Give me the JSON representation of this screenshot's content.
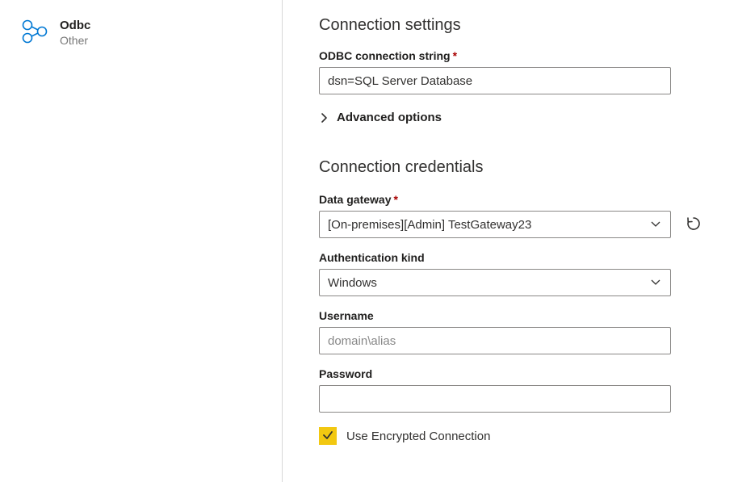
{
  "connector": {
    "title": "Odbc",
    "subtitle": "Other"
  },
  "settings": {
    "heading": "Connection settings",
    "conn_string_label": "ODBC connection string",
    "conn_string_value": "dsn=SQL Server Database",
    "advanced_label": "Advanced options"
  },
  "credentials": {
    "heading": "Connection credentials",
    "gateway_label": "Data gateway",
    "gateway_value": "[On-premises][Admin] TestGateway23",
    "auth_label": "Authentication kind",
    "auth_value": "Windows",
    "username_label": "Username",
    "username_placeholder": "domain\\alias",
    "password_label": "Password",
    "encrypted_label": "Use Encrypted Connection"
  }
}
